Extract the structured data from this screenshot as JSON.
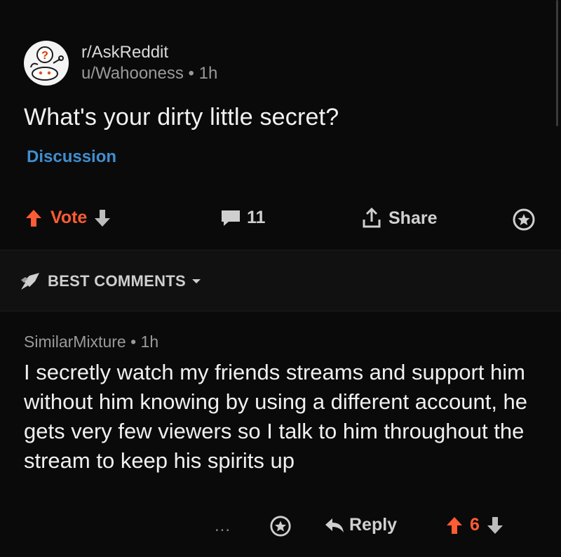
{
  "post": {
    "subreddit": "r/AskReddit",
    "author": "u/Wahooness",
    "separator": "•",
    "age": "1h",
    "title": "What's your dirty little secret?",
    "flair": "Discussion",
    "avatar_icon": "question-mark-snoo-icon"
  },
  "actions": {
    "vote_label": "Vote",
    "comment_count": "11",
    "share_label": "Share"
  },
  "sort": {
    "label": "BEST COMMENTS"
  },
  "comment": {
    "author": "SimilarMixture",
    "separator": "•",
    "age": "1h",
    "body": "I secretly watch my friends streams and support him without him knowing by using a different account, he gets very few viewers so I talk to him throughout the stream to keep his spirits up",
    "more": "...",
    "reply_label": "Reply",
    "score": "6"
  },
  "colors": {
    "upvote": "#ff5c33",
    "flair": "#3f8fd0",
    "background": "#0a0a0a"
  }
}
